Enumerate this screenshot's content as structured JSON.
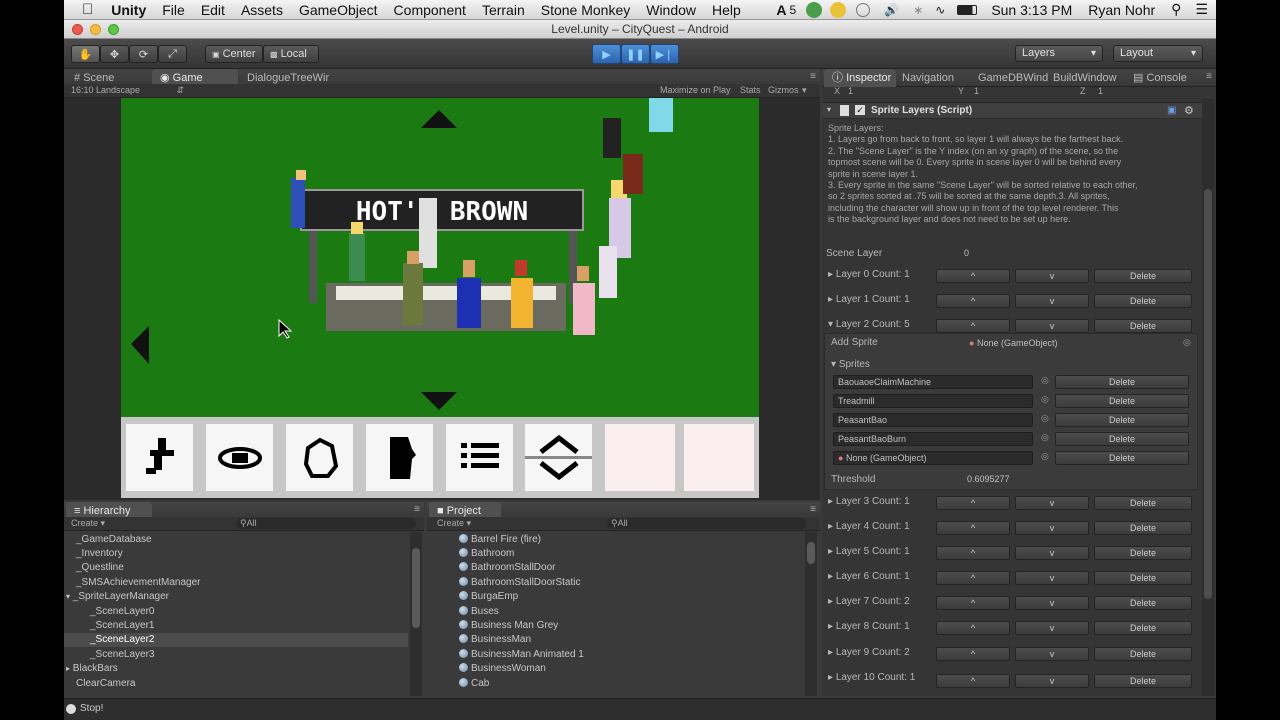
{
  "menubar": {
    "app": "Unity",
    "items": [
      "File",
      "Edit",
      "Assets",
      "GameObject",
      "Component",
      "Terrain",
      "Stone Monkey",
      "Window",
      "Help"
    ],
    "badge": "5",
    "clock": "Sun 3:13 PM",
    "user": "Ryan Nohr"
  },
  "window": {
    "title": "Level.unity – CityQuest – Android"
  },
  "toolbar": {
    "pivot": "Center",
    "space": "Local",
    "layers": "Layers",
    "layout": "Layout"
  },
  "scene_panel": {
    "tabs": [
      "Scene",
      "Game",
      "DialogueTreeWir"
    ],
    "aspect": "16:10 Landscape",
    "maximize": "Maximize on Play",
    "stats": "Stats",
    "gizmos": "Gizmos"
  },
  "game": {
    "sign": "HOT'N BROWN"
  },
  "hierarchy": {
    "title": "Hierarchy",
    "create": "Create",
    "search": "All",
    "items": [
      "_GameDatabase",
      "_Inventory",
      "_Questline",
      "_SMSAchievementManager",
      "_SpriteLayerManager",
      "_SceneLayer0",
      "_SceneLayer1",
      "_SceneLayer2",
      "_SceneLayer3",
      "BlackBars",
      "ClearCamera"
    ]
  },
  "project": {
    "title": "Project",
    "create": "Create",
    "search": "All",
    "items": [
      "Barrel Fire (fire)",
      "Bathroom",
      "BathroomStallDoor",
      "BathroomStallDoorStatic",
      "BurgaEmp",
      "Buses",
      "Business Man Grey",
      "BusinessMan",
      "BusinessMan Animated 1",
      "BusinessWoman",
      "Cab"
    ]
  },
  "inspector": {
    "tabs": [
      "Inspector",
      "Navigation",
      "GameDBWind",
      "BuildWindow",
      "Console"
    ],
    "x_label": "X",
    "x": "1",
    "y_label": "Y",
    "y": "1",
    "z_label": "Z",
    "z": "1",
    "component": "Sprite Layers (Script)",
    "help": [
      "Sprite Layers:",
      "1. Layers go from back to front, so layer 1 will always be the farthest back.",
      "2. The \"Scene Layer\" is the Y index (on an xy graph) of the scene, so the",
      "topmost scene will be 0. Every sprite in scene layer 0 will be behind every",
      "sprite in scene layer 1.",
      "3. Every sprite in the same \"Scene Layer\" will be sorted relative to each other,",
      "so 2 sprites sorted at .75 will be sorted at the same depth.3. All sprites,",
      "including the character will show up in front of the top level renderer. This",
      "is the background layer and does not need to be set up here."
    ],
    "scene_layer_label": "Scene Layer",
    "scene_layer": "0",
    "up": "^",
    "down": "v",
    "delete": "Delete",
    "layers_top": [
      "Layer 0 Count: 1",
      "Layer 1 Count: 1",
      "Layer 2 Count: 5"
    ],
    "add_sprite_label": "Add Sprite",
    "add_sprite_value": "None (GameObject)",
    "sprites_label": "Sprites",
    "sprites": [
      "BaouaoeClaimMachine",
      "Treadmill",
      "PeasantBao",
      "PeasantBaoBurn",
      "None (GameObject)"
    ],
    "threshold_label": "Threshold",
    "threshold": "0.6095277",
    "layers_bottom": [
      "Layer 3 Count: 1",
      "Layer 4 Count: 1",
      "Layer 5 Count: 1",
      "Layer 6 Count: 1",
      "Layer 7 Count: 2",
      "Layer 8 Count: 1",
      "Layer 9 Count: 2",
      "Layer 10 Count: 1"
    ]
  },
  "status": {
    "text": "Stop!"
  }
}
